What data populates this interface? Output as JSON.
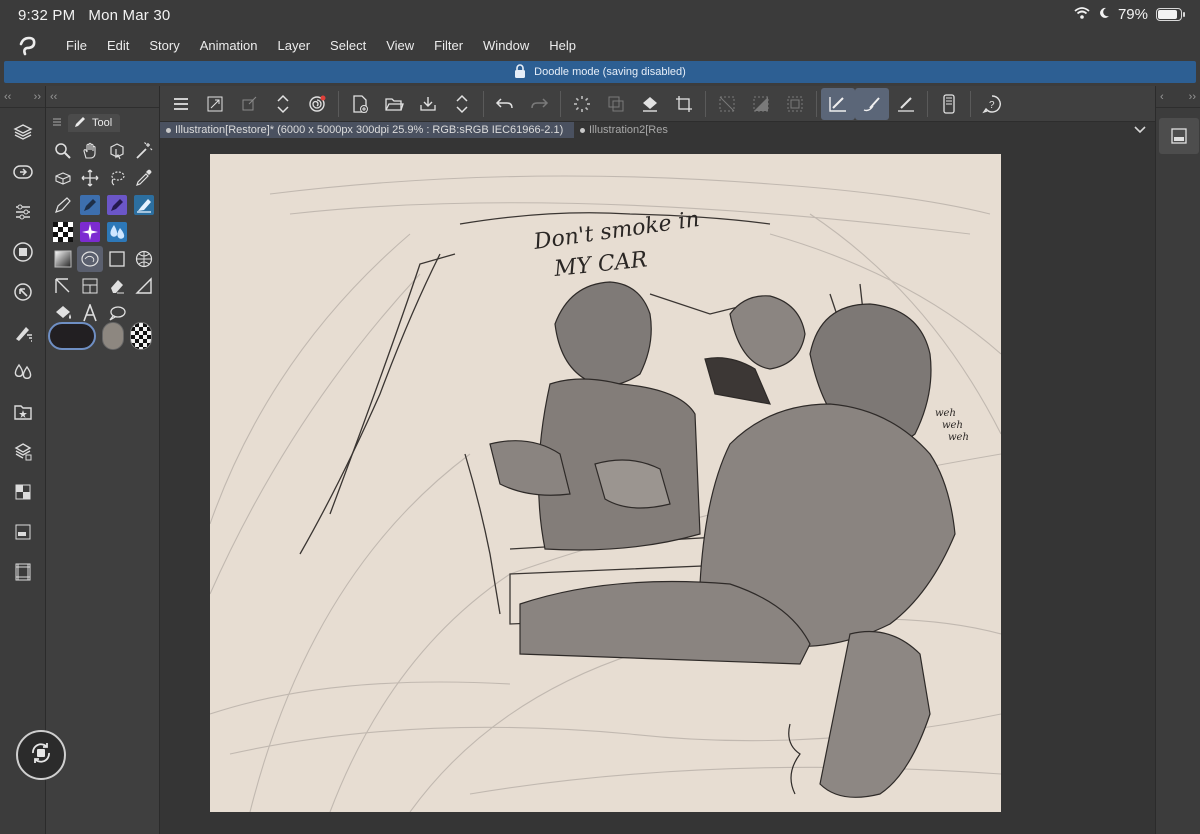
{
  "status": {
    "time": "9:32 PM",
    "date": "Mon Mar 30",
    "battery": "79%"
  },
  "menu": [
    "File",
    "Edit",
    "Story",
    "Animation",
    "Layer",
    "Select",
    "View",
    "Filter",
    "Window",
    "Help"
  ],
  "banner": {
    "text": "Doodle mode (saving disabled)"
  },
  "tool_panel": {
    "title": "Tool"
  },
  "tabs": [
    {
      "label": "Illustration[Restore]* (6000 x 5000px 300dpi 25.9% : RGB:sRGB IEC61966-2.1)",
      "active": true
    },
    {
      "label": "Illustration2[Res",
      "active": false
    }
  ],
  "canvas": {
    "paper_color": "#e7ddd2",
    "annotation_line1": "Don't smoke in",
    "annotation_line2": "MY CAR",
    "side_note": [
      "weh",
      "weh",
      "weh"
    ]
  },
  "colors": {
    "accent": "#2d5f93",
    "main_color": "#221f22",
    "sub_color": "#8d8780"
  }
}
